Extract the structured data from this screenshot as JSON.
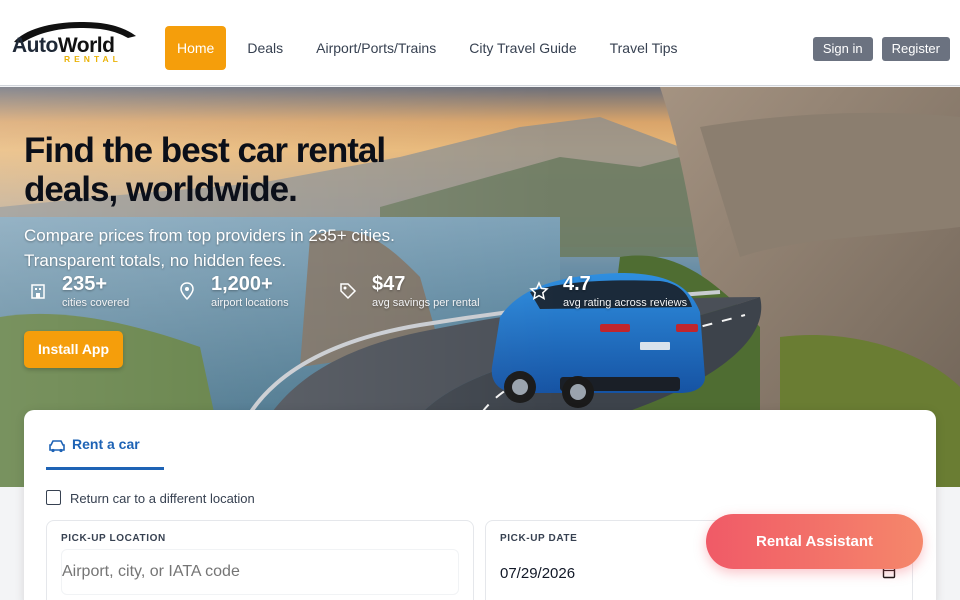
{
  "brand": {
    "name_part1": "Auto",
    "name_part2": "World",
    "tagline": "RENTAL"
  },
  "nav": {
    "items": [
      {
        "label": "Home",
        "active": true
      },
      {
        "label": "Deals",
        "active": false
      },
      {
        "label": "Airport/Ports/Trains",
        "active": false
      },
      {
        "label": "City Travel Guide",
        "active": false
      },
      {
        "label": "Travel Tips",
        "active": false
      }
    ],
    "sign_in": "Sign in",
    "register": "Register"
  },
  "hero": {
    "title": "Find the best car rental deals, worldwide.",
    "subtitle": "Compare prices from top providers in 235+ cities. Transparent totals, no hidden fees.",
    "stats": [
      {
        "value": "235+",
        "label": "cities covered",
        "icon": "building-icon"
      },
      {
        "value": "1,200+",
        "label": "airport locations",
        "icon": "map-pin-icon"
      },
      {
        "value": "$47",
        "label": "avg savings per rental",
        "icon": "tag-icon"
      },
      {
        "value": "4.7",
        "label": "avg rating across reviews",
        "icon": "star-icon"
      }
    ],
    "install_button": " Install App"
  },
  "search": {
    "tab_label": "Rent a car",
    "return_label": "Return car to a different location",
    "return_checked": false,
    "pickup_location": {
      "label": "PICK-UP LOCATION",
      "placeholder": "Airport, city, or IATA code",
      "value": ""
    },
    "pickup_date": {
      "label": "PICK-UP DATE",
      "value": "07/29/2026"
    }
  },
  "assistant": {
    "label": " Rental Assistant"
  },
  "colors": {
    "accent": "#f59e0b",
    "primary": "#1e63b5",
    "assistant_start": "#f05a67",
    "assistant_end": "#f5876b",
    "auth_button": "#6b7280"
  }
}
